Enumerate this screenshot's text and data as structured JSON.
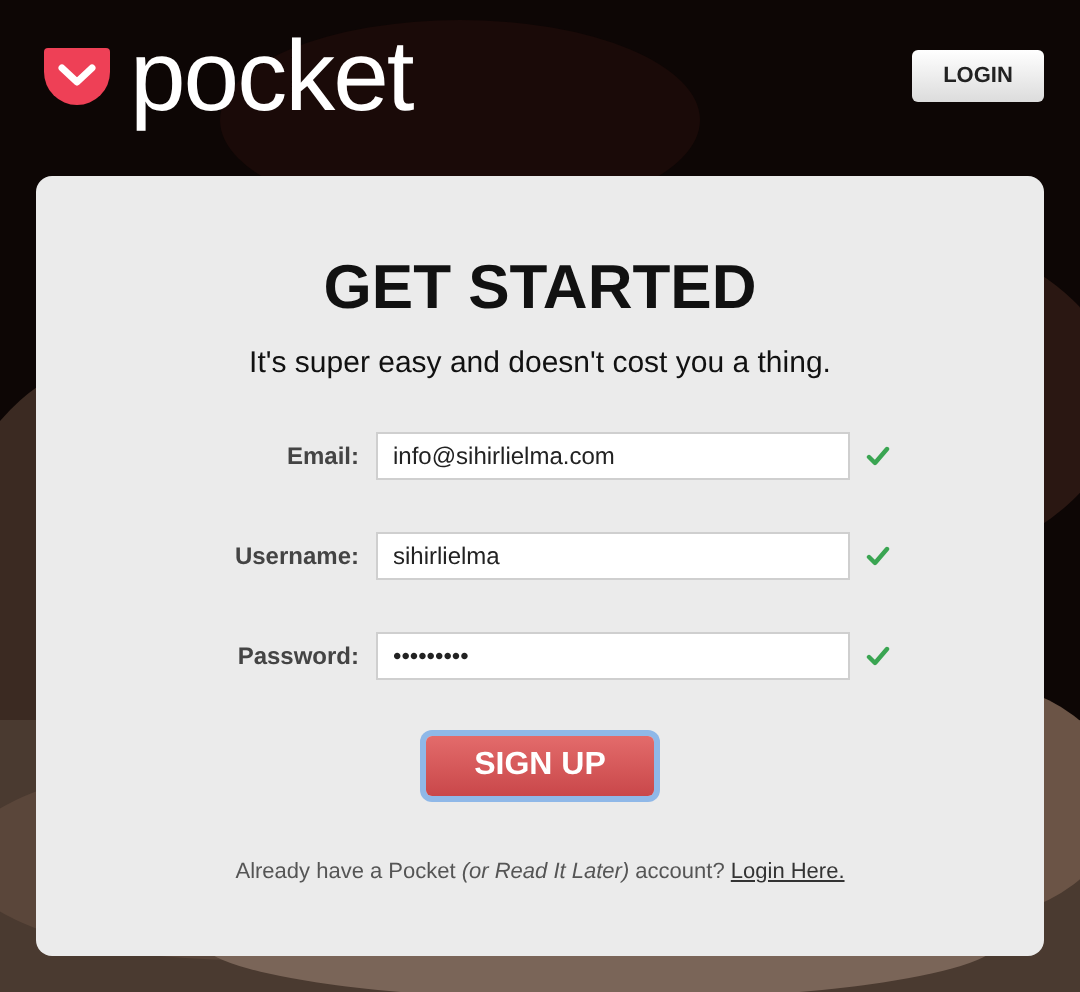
{
  "header": {
    "logo": "pocket",
    "login_button": "LOGIN"
  },
  "card": {
    "title": "GET STARTED",
    "subtitle": "It's super easy and doesn't cost you a thing.",
    "fields": [
      {
        "label": "Email:",
        "value": "info@sihirlielma.com",
        "valid": true
      },
      {
        "label": "Username:",
        "value": "sihirlielma",
        "valid": true
      },
      {
        "label": "Password:",
        "value": "•••••••••",
        "valid": true
      }
    ],
    "signup_button": {
      "label": "SIGN UP",
      "focused": true
    },
    "footer": {
      "text": "Already have a Pocket *(or Read It Later)* account?",
      "link": "Login Here."
    }
  }
}
